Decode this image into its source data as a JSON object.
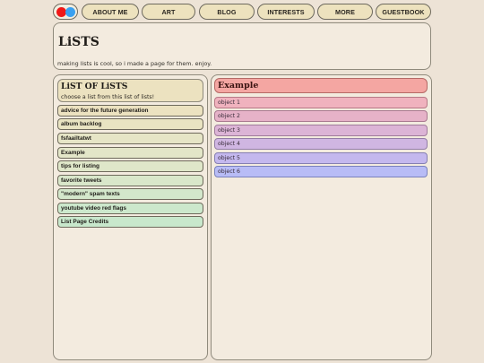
{
  "nav": {
    "logo_colors": [
      "#f01818",
      "#3aa0f0"
    ],
    "items": [
      {
        "label": "ABOUT ME"
      },
      {
        "label": "ART"
      },
      {
        "label": "BLOG"
      },
      {
        "label": "INTERESTS"
      },
      {
        "label": "MORE"
      },
      {
        "label": "GUESTBOOK"
      }
    ]
  },
  "header": {
    "title": "LiSTS",
    "subtitle": "making lists is cool, so i made a page for them. enjoy."
  },
  "list_panel": {
    "title": "LiST OF LiSTS",
    "subtitle": "choose a list from this list of lists!",
    "items": [
      {
        "label": "advice for the future generation",
        "color": "#ece2c0"
      },
      {
        "label": "album backlog",
        "color": "#e9e4c2"
      },
      {
        "label": "fsfaailtatwt",
        "color": "#e6e5c6"
      },
      {
        "label": "Example",
        "color": "#e3e6c8"
      },
      {
        "label": "tips for listing",
        "color": "#dfe7c9"
      },
      {
        "label": "favorite tweets",
        "color": "#d9e7ca"
      },
      {
        "label": "\"modern\" spam texts",
        "color": "#d3e7cb"
      },
      {
        "label": "youtube video red flags",
        "color": "#cce8cc"
      },
      {
        "label": "List Page Credits",
        "color": "#c8e8cc"
      }
    ]
  },
  "detail_panel": {
    "title": "Example",
    "title_color": "#f4a6a2",
    "objects": [
      {
        "label": "object 1",
        "color": "#f0b2be",
        "border": "#b77a86"
      },
      {
        "label": "object 2",
        "color": "#e6b2c8",
        "border": "#a97a90"
      },
      {
        "label": "object 3",
        "color": "#dcb4d6",
        "border": "#a07c9c"
      },
      {
        "label": "object 4",
        "color": "#d0b6e2",
        "border": "#937ea6"
      },
      {
        "label": "object 5",
        "color": "#c4b8ee",
        "border": "#8680b2"
      },
      {
        "label": "object 6",
        "color": "#b8bcf6",
        "border": "#7a82bc"
      }
    ]
  }
}
